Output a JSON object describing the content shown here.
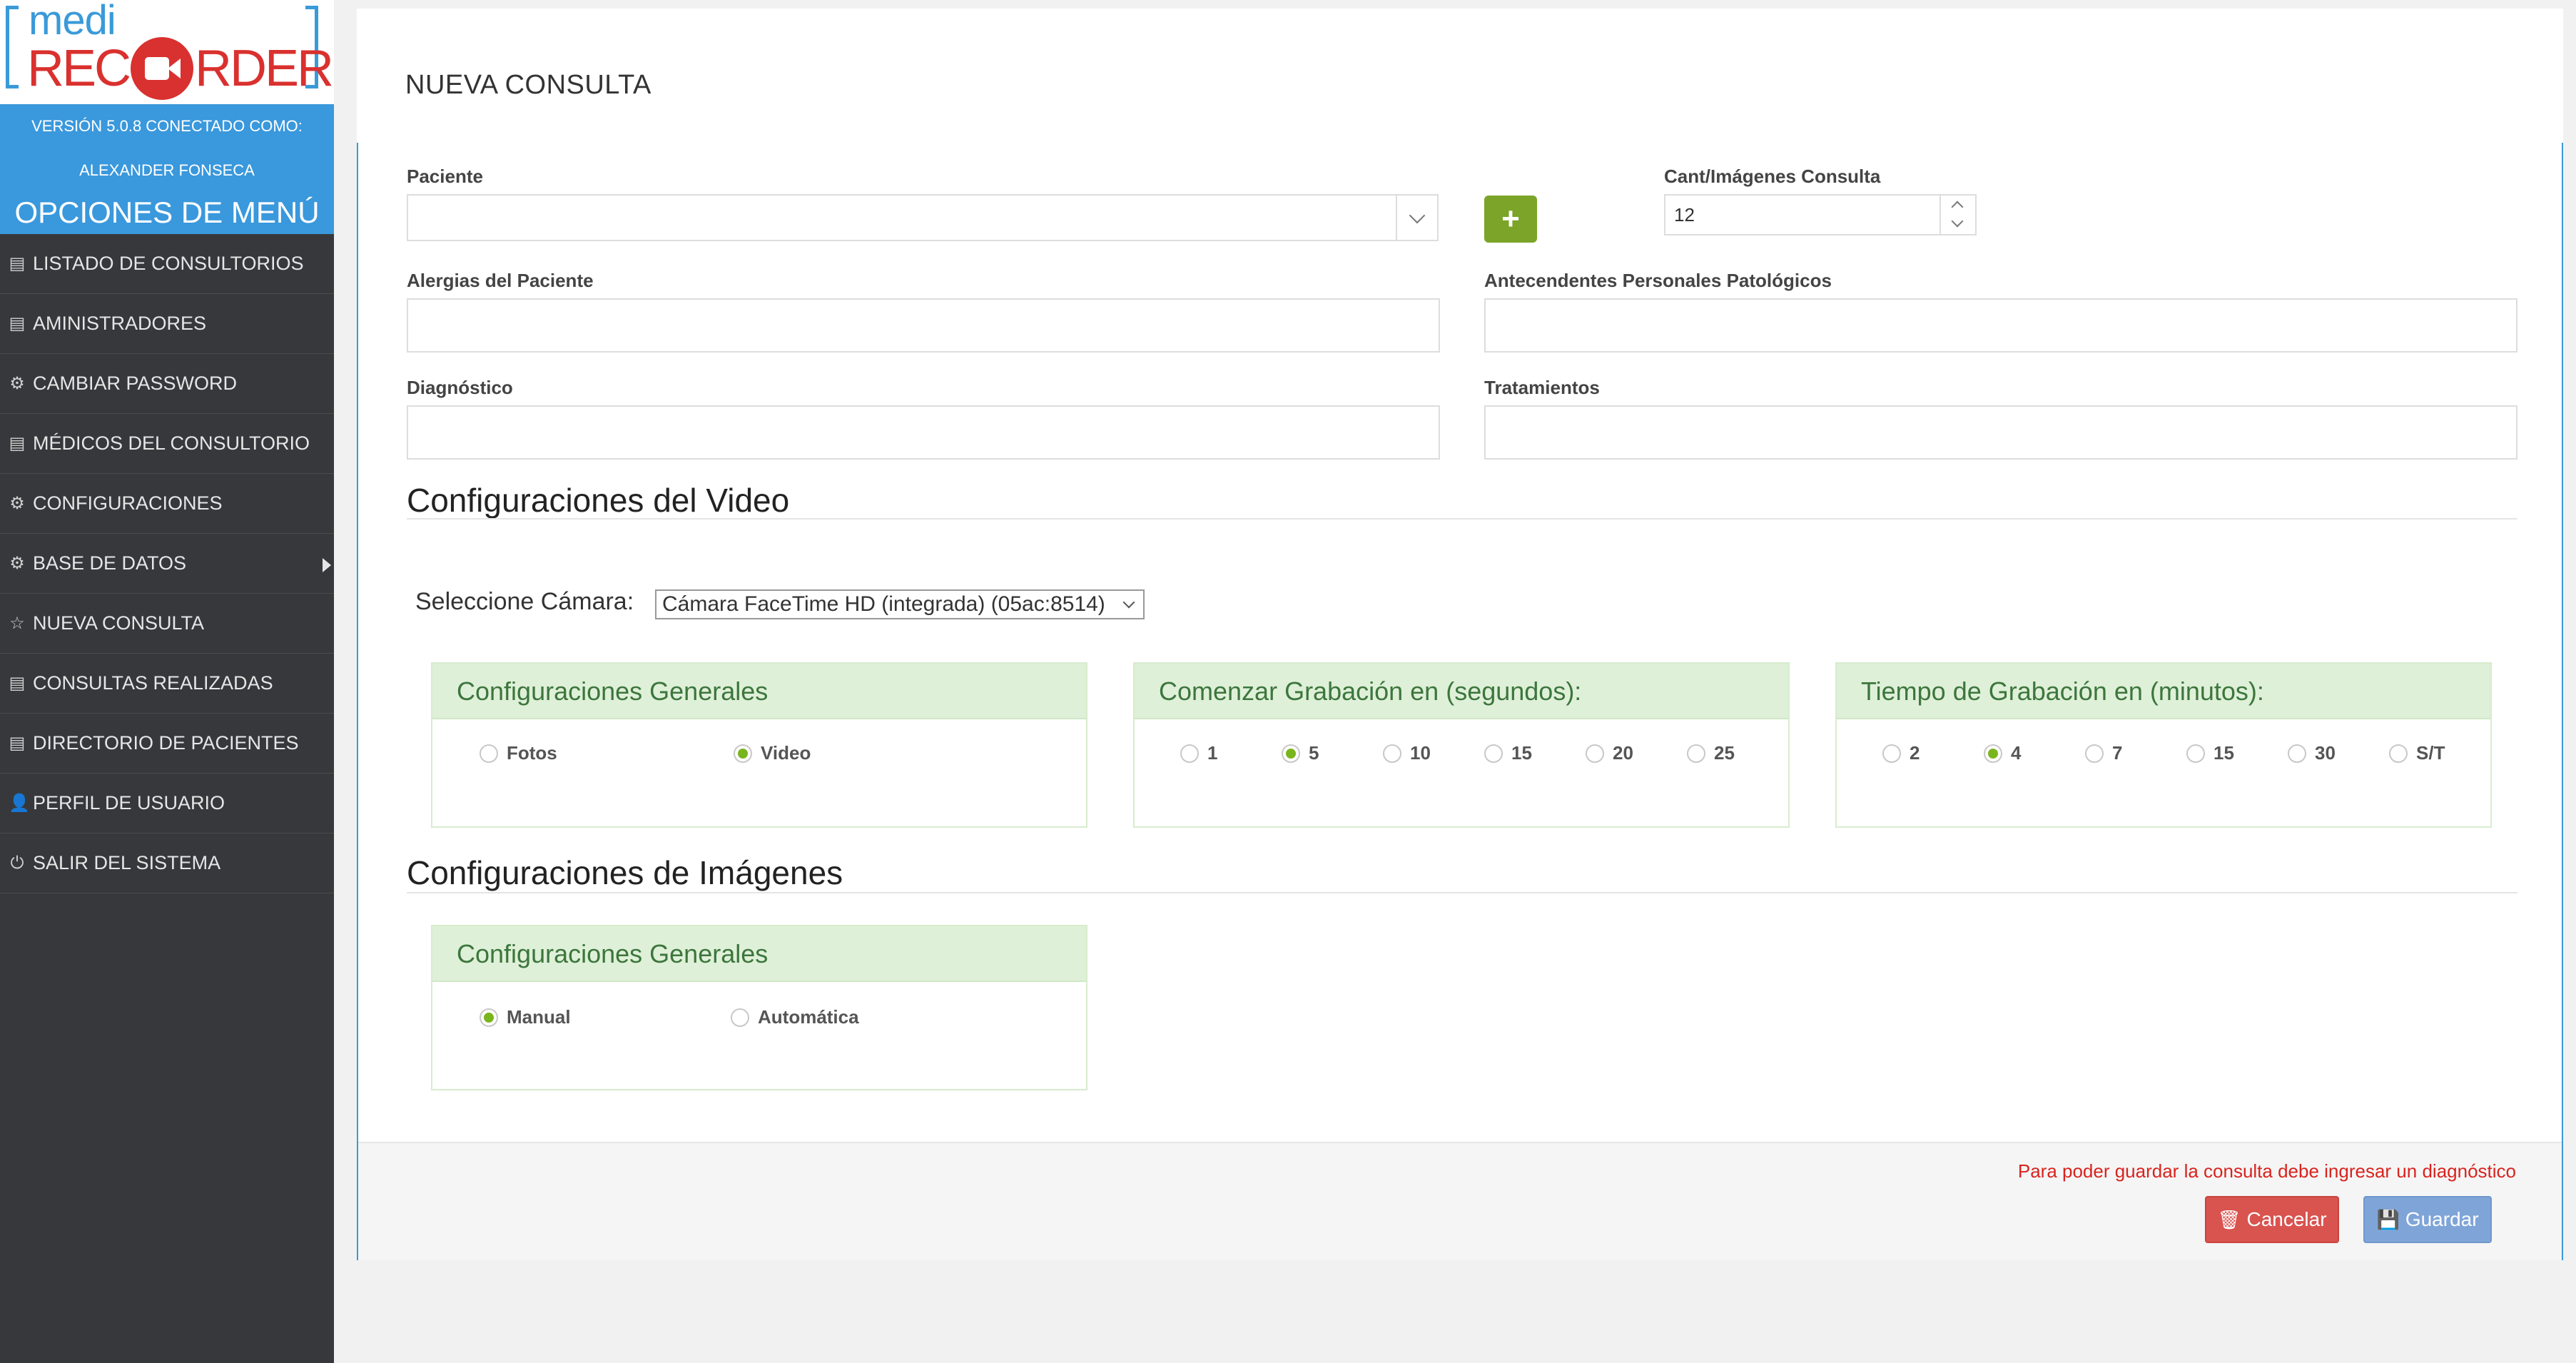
{
  "logo": {
    "top": "medi",
    "bottom_left": "REC",
    "bottom_right": "RDER"
  },
  "sidebar": {
    "version_line": "VERSIÓN 5.0.8  CONECTADO COMO:",
    "user": "ALEXANDER FONSECA",
    "menu_title": "OPCIONES DE MENÚ",
    "items": [
      {
        "label": "LISTADO DE CONSULTORIOS",
        "icon": "list-icon"
      },
      {
        "label": "AMINISTRADORES",
        "icon": "list-icon"
      },
      {
        "label": "CAMBIAR PASSWORD",
        "icon": "gear-icon"
      },
      {
        "label": "MÉDICOS DEL CONSULTORIO",
        "icon": "list-icon"
      },
      {
        "label": "CONFIGURACIONES",
        "icon": "gear-icon"
      },
      {
        "label": "BASE DE DATOS",
        "icon": "gear-icon"
      },
      {
        "label": "NUEVA CONSULTA",
        "icon": "star-icon"
      },
      {
        "label": "CONSULTAS REALIZADAS",
        "icon": "list-icon"
      },
      {
        "label": "DIRECTORIO DE PACIENTES",
        "icon": "list-icon"
      },
      {
        "label": "PERFIL DE USUARIO",
        "icon": "user-icon"
      },
      {
        "label": "SALIR DEL SISTEMA",
        "icon": "power-icon"
      }
    ]
  },
  "page": {
    "title": "NUEVA CONSULTA"
  },
  "form": {
    "paciente_label": "Paciente",
    "paciente_value": "",
    "cant_label": "Cant/Imágenes Consulta",
    "cant_value": "12",
    "alergias_label": "Alergias del Paciente",
    "alergias_value": "",
    "antecedentes_label": "Antecendentes Personales Patológicos",
    "antecedentes_value": "",
    "diagnostico_label": "Diagnóstico",
    "diagnostico_value": "",
    "tratamientos_label": "Tratamientos",
    "tratamientos_value": ""
  },
  "video": {
    "section_title": "Configuraciones del Video",
    "camera_label": "Seleccione Cámara:",
    "camera_value": "Cámara FaceTime HD (integrada) (05ac:8514)",
    "general_title": "Configuraciones Generales",
    "general_options": [
      "Fotos",
      "Video"
    ],
    "general_selected": 1,
    "start_title": "Comenzar Grabación en (segundos):",
    "start_options": [
      "1",
      "5",
      "10",
      "15",
      "20",
      "25"
    ],
    "start_selected": 1,
    "duration_title": "Tiempo de Grabación en (minutos):",
    "duration_options": [
      "2",
      "4",
      "7",
      "15",
      "30",
      "S/T"
    ],
    "duration_selected": 1
  },
  "images": {
    "section_title": "Configuraciones de Imágenes",
    "general_title": "Configuraciones Generales",
    "options": [
      "Manual",
      "Automática"
    ],
    "selected": 0
  },
  "footer": {
    "warning": "Para poder guardar la consulta debe ingresar un diagnóstico",
    "cancel_label": "Cancelar",
    "save_label": "Guardar"
  },
  "colors": {
    "accent": "#3a98dc",
    "brand_red": "#d9312f",
    "radio_on": "#7ab51d",
    "danger": "#d9534f"
  }
}
